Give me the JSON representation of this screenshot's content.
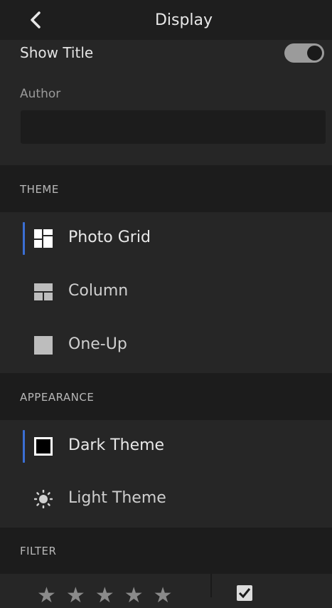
{
  "header": {
    "title": "Display",
    "back_icon": "chevron-left-icon"
  },
  "show_title": {
    "label": "Show Title",
    "enabled": true
  },
  "author": {
    "label": "Author",
    "value": "",
    "placeholder": ""
  },
  "theme": {
    "section_label": "THEME",
    "items": [
      {
        "label": "Photo Grid",
        "icon": "photo-grid-icon",
        "selected": true
      },
      {
        "label": "Column",
        "icon": "column-layout-icon",
        "selected": false
      },
      {
        "label": "One-Up",
        "icon": "one-up-icon",
        "selected": false
      }
    ]
  },
  "appearance": {
    "section_label": "APPEARANCE",
    "items": [
      {
        "label": "Dark Theme",
        "icon": "dark-theme-square-icon",
        "selected": true
      },
      {
        "label": "Light Theme",
        "icon": "sun-icon",
        "selected": false
      }
    ]
  },
  "filter": {
    "section_label": "FILTER",
    "rating_stars": 5,
    "flag_checked": true
  },
  "colors": {
    "background": "#262626",
    "section_background": "#1c1c1c",
    "selection_accent": "#3b6fd4",
    "toggle_on": "#9b9b9b"
  }
}
